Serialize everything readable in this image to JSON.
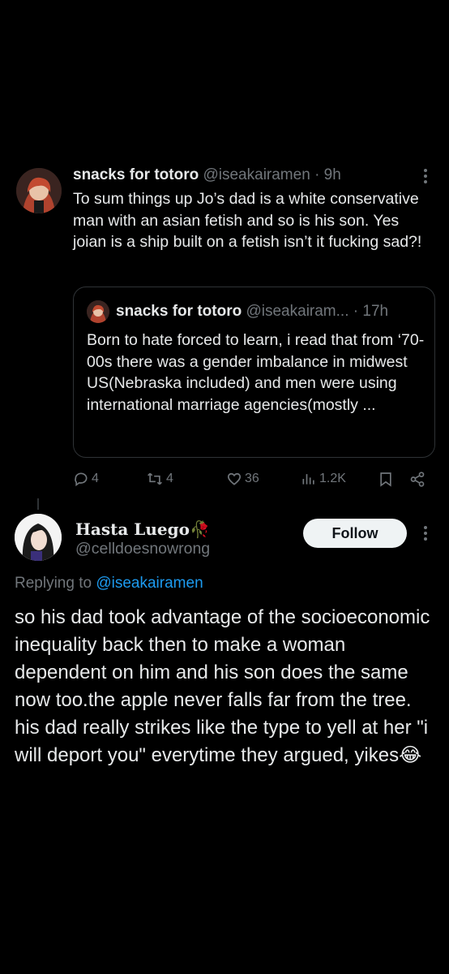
{
  "tweet": {
    "author_name": "snacks for totoro",
    "handle": "@iseakairamen",
    "separator": "·",
    "time": "9h",
    "text": "To sum things up Jo’s dad is a white conservative man with an asian fetish and so is his son. Yes joian is a ship built on a fetish isn’t it fucking sad?!",
    "quote": {
      "author_name": "snacks for totoro",
      "handle": "@iseakairam...",
      "separator": "·",
      "time": "17h",
      "text": "Born to hate forced to learn, i read that from ‘70-00s there was a gender imbalance in midwest US(Nebraska included) and men were using international marriage agencies(mostly ..."
    },
    "actions": {
      "replies": "4",
      "reposts": "4",
      "likes": "36",
      "views": "1.2K"
    }
  },
  "reply": {
    "author_name": "Hasta Luego",
    "author_emoji": "🥀",
    "handle": "@celldoesnowrong",
    "follow_label": "Follow",
    "replying_prefix": "Replying to",
    "replying_to": "@iseakairamen",
    "text": "so his dad took advantage of the socioeconomic inequality back then to make a woman dependent on him and his son does the same now too.the apple never falls far from the tree. his dad really strikes like the type to yell at her \"i will deport you\" everytime they argued, yikes",
    "text_emoji": "😂"
  },
  "colors": {
    "background": "#000000",
    "text": "#e7e9ea",
    "muted": "#71767b",
    "link": "#1d9bf0",
    "border": "#2f3336",
    "follow_bg": "#eff3f4"
  }
}
